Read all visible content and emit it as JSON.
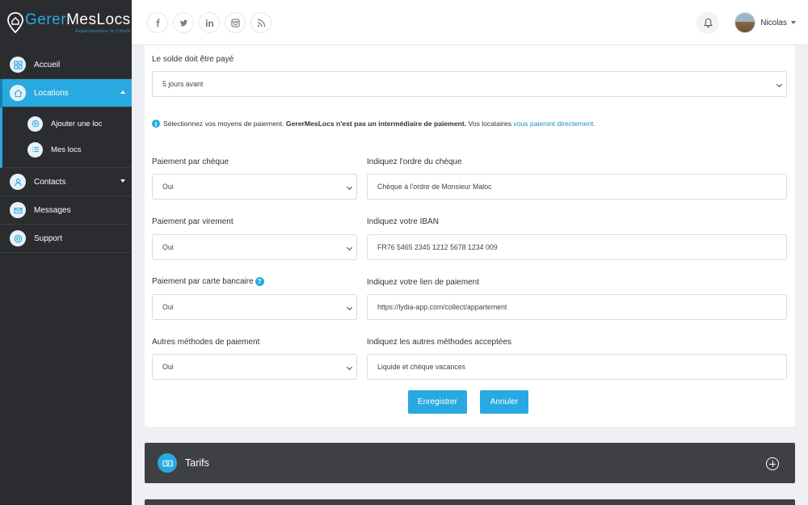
{
  "brand": {
    "name_part1": "Gerer",
    "name_part2": "MesLocs",
    "tagline": "Expérimentons le Côtelé",
    "accent_color": "#29a9e1"
  },
  "sidebar": {
    "items": [
      {
        "label": "Accueil",
        "icon": "grid-icon"
      },
      {
        "label": "Locations",
        "icon": "home-icon",
        "active": true
      },
      {
        "label": "Contacts",
        "icon": "user-icon"
      },
      {
        "label": "Messages",
        "icon": "mail-icon"
      },
      {
        "label": "Support",
        "icon": "lifebuoy-icon"
      }
    ],
    "sub_items": [
      {
        "label": "Ajouter une loc",
        "icon": "plus-circle-icon"
      },
      {
        "label": "Mes locs",
        "icon": "list-icon"
      }
    ]
  },
  "header": {
    "socials": [
      "facebook-icon",
      "twitter-icon",
      "linkedin-icon",
      "instagram-icon",
      "rss-icon"
    ],
    "user_name": "Nicolas"
  },
  "form": {
    "solde_label": "Le solde doit être payé",
    "solde_value": "5 jours avant",
    "info_text_1": "Sélectionnez vos moyens de paiement.",
    "info_text_bold": "GererMesLocs n'est pas un intermédiaire de paiement.",
    "info_text_2": "Vos locataires",
    "info_link": "vous paieront directement.",
    "rows": [
      {
        "left_label": "Paiement par chèque",
        "left_value": "Oui",
        "right_label": "Indiquez l'ordre du chèque",
        "right_value": "Chèque à l'ordre de Monsieur Maloc"
      },
      {
        "left_label": "Paiement par virement",
        "left_value": "Oui",
        "right_label": "Indiquez votre IBAN",
        "right_value": "FR76 5465 2345 1212 5678 1234 009"
      },
      {
        "left_label": "Paiement par carte bancaire",
        "left_value": "Oui",
        "right_label": "Indiquez votre lien de paiement",
        "right_value": "https://lydia-app.com/collect/appartement"
      },
      {
        "left_label": "Autres méthodes de paiement",
        "left_value": "Oui",
        "right_label": "Indiquez les autres méthodes acceptées",
        "right_value": "Liquide et chèque vacances"
      }
    ],
    "save_label": "Enregistrer",
    "cancel_label": "Annuler"
  },
  "tarifs": {
    "label": "Tarifs"
  }
}
